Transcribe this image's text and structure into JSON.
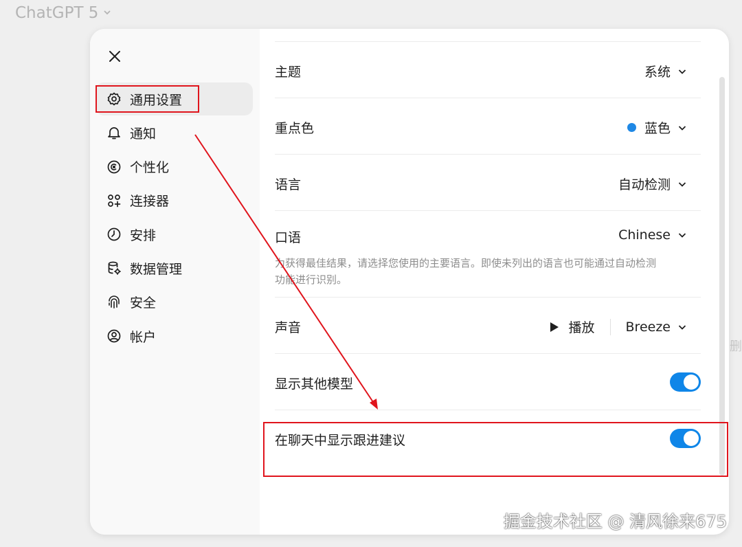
{
  "app": {
    "title": "ChatGPT 5"
  },
  "bg_edge_text": "删",
  "sidebar": {
    "close_icon": "close-icon",
    "items": [
      {
        "label": "通用设置",
        "icon": "gear-icon",
        "active": true
      },
      {
        "label": "通知",
        "icon": "bell-icon"
      },
      {
        "label": "个性化",
        "icon": "personalize-icon"
      },
      {
        "label": "连接器",
        "icon": "connectors-icon"
      },
      {
        "label": "安排",
        "icon": "clock-icon"
      },
      {
        "label": "数据管理",
        "icon": "database-icon"
      },
      {
        "label": "安全",
        "icon": "fingerprint-icon"
      },
      {
        "label": "帐户",
        "icon": "account-icon"
      }
    ]
  },
  "settings": {
    "theme": {
      "label": "主题",
      "value": "系统"
    },
    "accent": {
      "label": "重点色",
      "value": "蓝色",
      "color": "#1e88e5"
    },
    "language": {
      "label": "语言",
      "value": "自动检测"
    },
    "spoken": {
      "label": "口语",
      "value": "Chinese",
      "description": "为获得最佳结果，请选择您使用的主要语言。即使未列出的语言也可能通过自动检测功能进行识别。"
    },
    "voice": {
      "label": "声音",
      "play_label": "播放",
      "value": "Breeze"
    },
    "show_models": {
      "label": "显示其他模型",
      "enabled": true
    },
    "follow_up": {
      "label": "在聊天中显示跟进建议",
      "enabled": true
    }
  },
  "annotation_color": "#e0141c",
  "watermark": "掘金技术社区 @ 清风徐来675"
}
